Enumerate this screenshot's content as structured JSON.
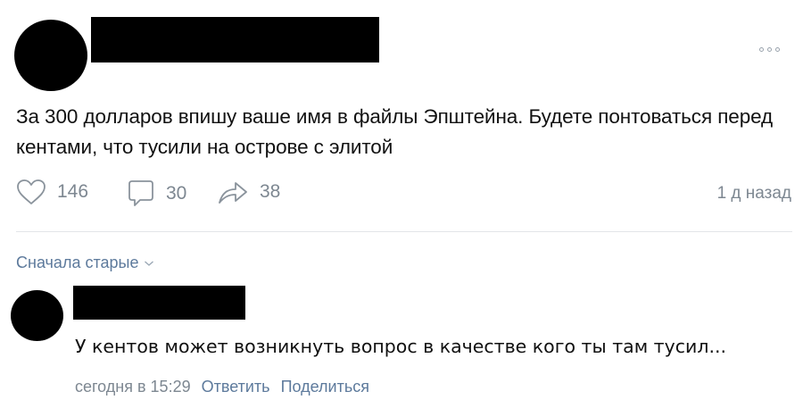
{
  "post": {
    "text": "За 300 долларов впишу ваше имя в файлы Эпштейна. Будете понтоваться перед кентами, что тусили на острове с элитой",
    "likes": "146",
    "comments": "30",
    "shares": "38",
    "date": "1 д назад"
  },
  "comments_section": {
    "sort_label": "Сначала старые"
  },
  "comment": {
    "text": "У кентов может возникнуть вопрос в качестве кого ты там тусил...",
    "time": "сегодня в 15:29",
    "reply_label": "Ответить",
    "share_label": "Поделиться"
  },
  "colors": {
    "icon_gray": "#7d8791",
    "link_blue": "#5d7a9c",
    "divider": "#e3e5e8",
    "redaction": "#000000"
  },
  "icons": [
    "more-dots-icon",
    "heart-icon",
    "comment-bubble-icon",
    "share-arrow-icon",
    "chevron-down-icon"
  ]
}
